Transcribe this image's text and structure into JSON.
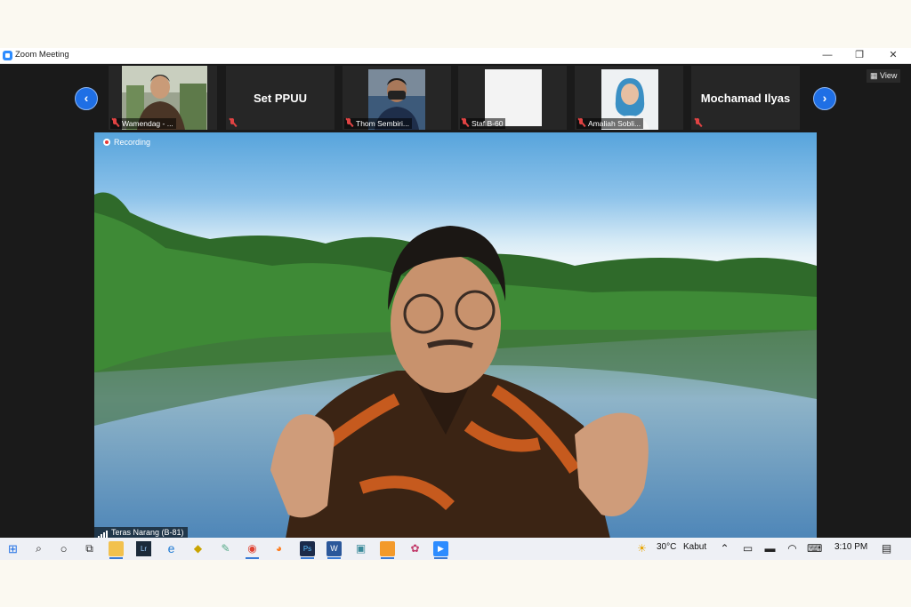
{
  "window": {
    "title": "Zoom Meeting",
    "minimize": "—",
    "restore": "❐",
    "close": "✕"
  },
  "strip": {
    "prev": "‹",
    "next": "›",
    "view_label": "View",
    "tiles": [
      {
        "label": "Wamendag - ..."
      },
      {
        "name": "Set PPUU"
      },
      {
        "label": "Thom Sembiri..."
      },
      {
        "label": "Staf B-60"
      },
      {
        "label": "Amaliah Sobli..."
      },
      {
        "name": "Mochamad Ilyas"
      }
    ]
  },
  "main": {
    "recording": "Recording",
    "speaker": "Teras Narang (B-81)"
  },
  "taskbar": {
    "weather_temp": "30°C",
    "weather_desc": "Kabut",
    "time": "3:10 PM"
  },
  "colors": {
    "zoom_blue": "#2d8cff",
    "nav_blue": "#1f6fe5",
    "mic_muted": "#e04343",
    "recording_red": "#e53935"
  }
}
